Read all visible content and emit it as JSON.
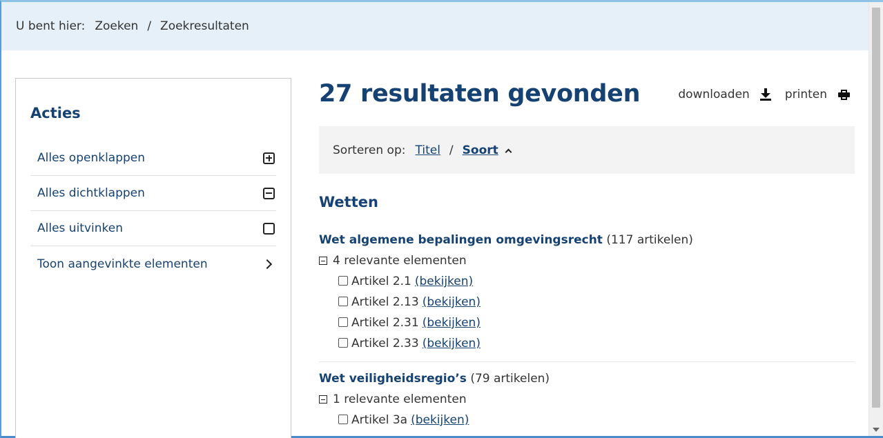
{
  "breadcrumb": {
    "lead": "U bent hier:",
    "items": [
      "Zoeken",
      "Zoekresultaten"
    ],
    "separator": "/"
  },
  "sidebar": {
    "title": "Acties",
    "items": [
      {
        "label": "Alles openklappen",
        "icon": "plus-square-icon"
      },
      {
        "label": "Alles dichtklappen",
        "icon": "minus-square-icon"
      },
      {
        "label": "Alles uitvinken",
        "icon": "empty-square-icon"
      },
      {
        "label": "Toon aangevinkte elementen",
        "icon": "chevron-right-icon"
      }
    ]
  },
  "main": {
    "title": "27 resultaten gevonden",
    "actions": {
      "download_label": "downloaden",
      "print_label": "printen"
    },
    "sort": {
      "label": "Sorteren op:",
      "options": [
        "Titel",
        "Soort"
      ],
      "active": "Soort",
      "separator": "/"
    },
    "section_title": "Wetten",
    "groups": [
      {
        "name": "Wet algemene bepalingen omgevingsrecht",
        "count": "(117 artikelen)",
        "relevant": "4 relevante elementen",
        "articles": [
          {
            "label": "Artikel 2.1",
            "link": "(bekijken)"
          },
          {
            "label": "Artikel 2.13",
            "link": "(bekijken)"
          },
          {
            "label": "Artikel 2.31",
            "link": "(bekijken)"
          },
          {
            "label": "Artikel 2.33",
            "link": "(bekijken)"
          }
        ]
      },
      {
        "name": "Wet veiligheidsregio’s",
        "count": "(79 artikelen)",
        "relevant": "1 relevante elementen",
        "articles": [
          {
            "label": "Artikel 3a",
            "link": "(bekijken)"
          }
        ]
      }
    ]
  },
  "colors": {
    "brand_blue": "#154273",
    "breadcrumb_bg": "#e5f0f9",
    "sortbar_bg": "#f3f3f3"
  }
}
